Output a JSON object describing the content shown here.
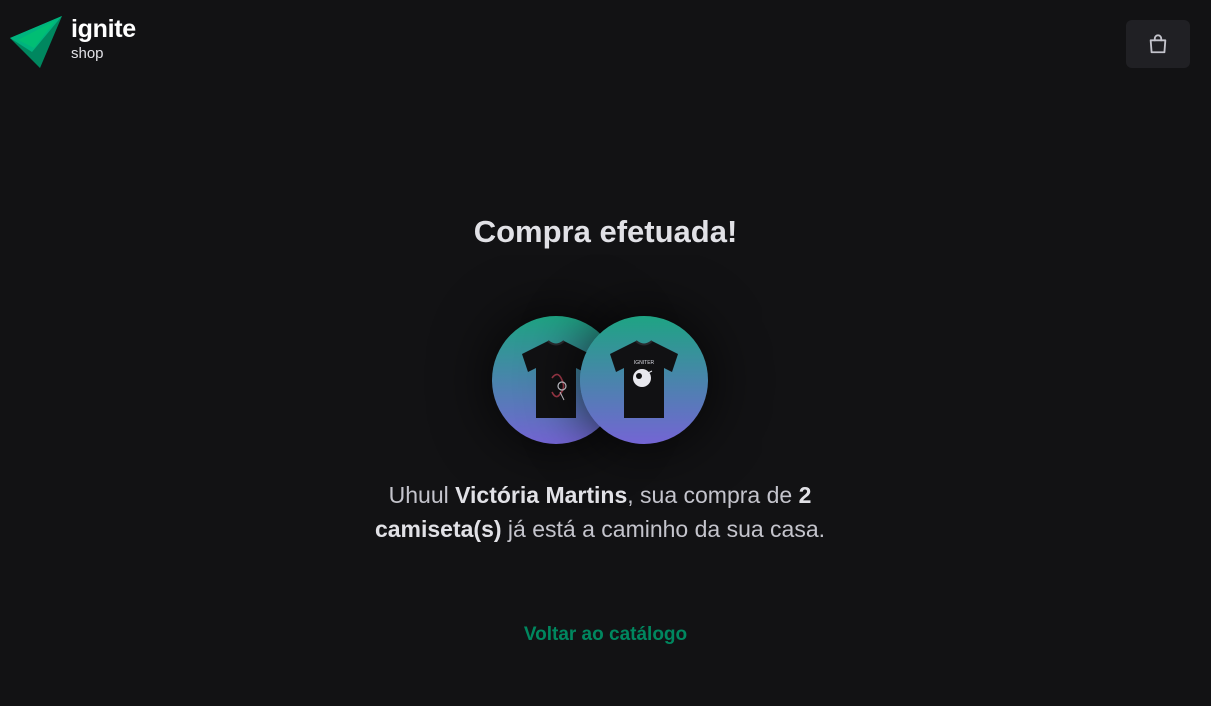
{
  "header": {
    "logo_name": "ignite",
    "logo_sub": "shop",
    "cart_icon": "shopping-bag-icon"
  },
  "main": {
    "title": "Compra efetuada!",
    "products": [
      {
        "icon": "tshirt-image"
      },
      {
        "icon": "tshirt-image"
      }
    ],
    "message": {
      "prefix": "Uhuul ",
      "customer_name": "Victória Martins",
      "middle": ", sua compra de ",
      "items": "2 camiseta(s)",
      "suffix": " já está a caminho da sua casa."
    },
    "back_link": "Voltar ao catálogo"
  },
  "colors": {
    "background": "#121214",
    "accent": "#00875f",
    "gradient_start": "#1ea483",
    "gradient_end": "#7465d4"
  }
}
